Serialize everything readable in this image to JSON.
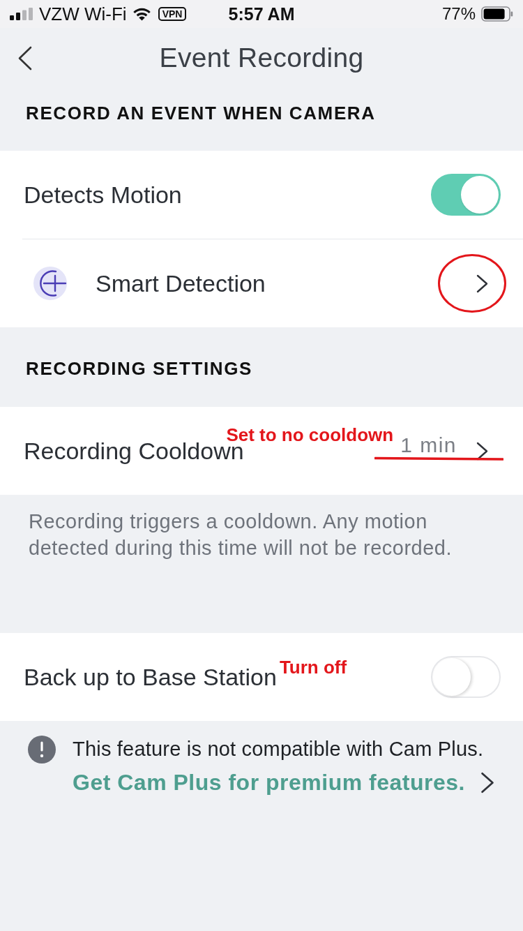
{
  "status_bar": {
    "carrier": "VZW Wi-Fi",
    "vpn": "VPN",
    "time": "5:57 AM",
    "battery": "77%"
  },
  "nav_bar": {
    "title": "Event Recording"
  },
  "sections": [
    {
      "header": "RECORD AN EVENT WHEN CAMERA",
      "rows": [
        {
          "kind": "toggle",
          "label": "Detects Motion",
          "on": true
        },
        {
          "kind": "link",
          "label": "Smart Detection",
          "leading_icon": true,
          "marks": [
            {
              "kind": "circle"
            }
          ]
        }
      ]
    },
    {
      "header": "RECORDING SETTINGS",
      "rows": [
        {
          "kind": "link",
          "label": "Recording Cooldown",
          "value": "1 min",
          "marks": [
            {
              "kind": "note",
              "text": "Set to no cooldown"
            },
            {
              "kind": "strike"
            }
          ]
        }
      ],
      "footnote": "Recording triggers a cooldown. Any motion detected during this time will not be recorded."
    },
    {
      "rows": [
        {
          "kind": "toggle",
          "label": "Back up to Base Station",
          "on": false,
          "marks": [
            {
              "kind": "note",
              "text": "Turn off"
            }
          ]
        }
      ],
      "notice": {
        "text": "This feature is not compatible with Cam Plus.",
        "link": "Get Cam Plus for premium features."
      }
    }
  ]
}
